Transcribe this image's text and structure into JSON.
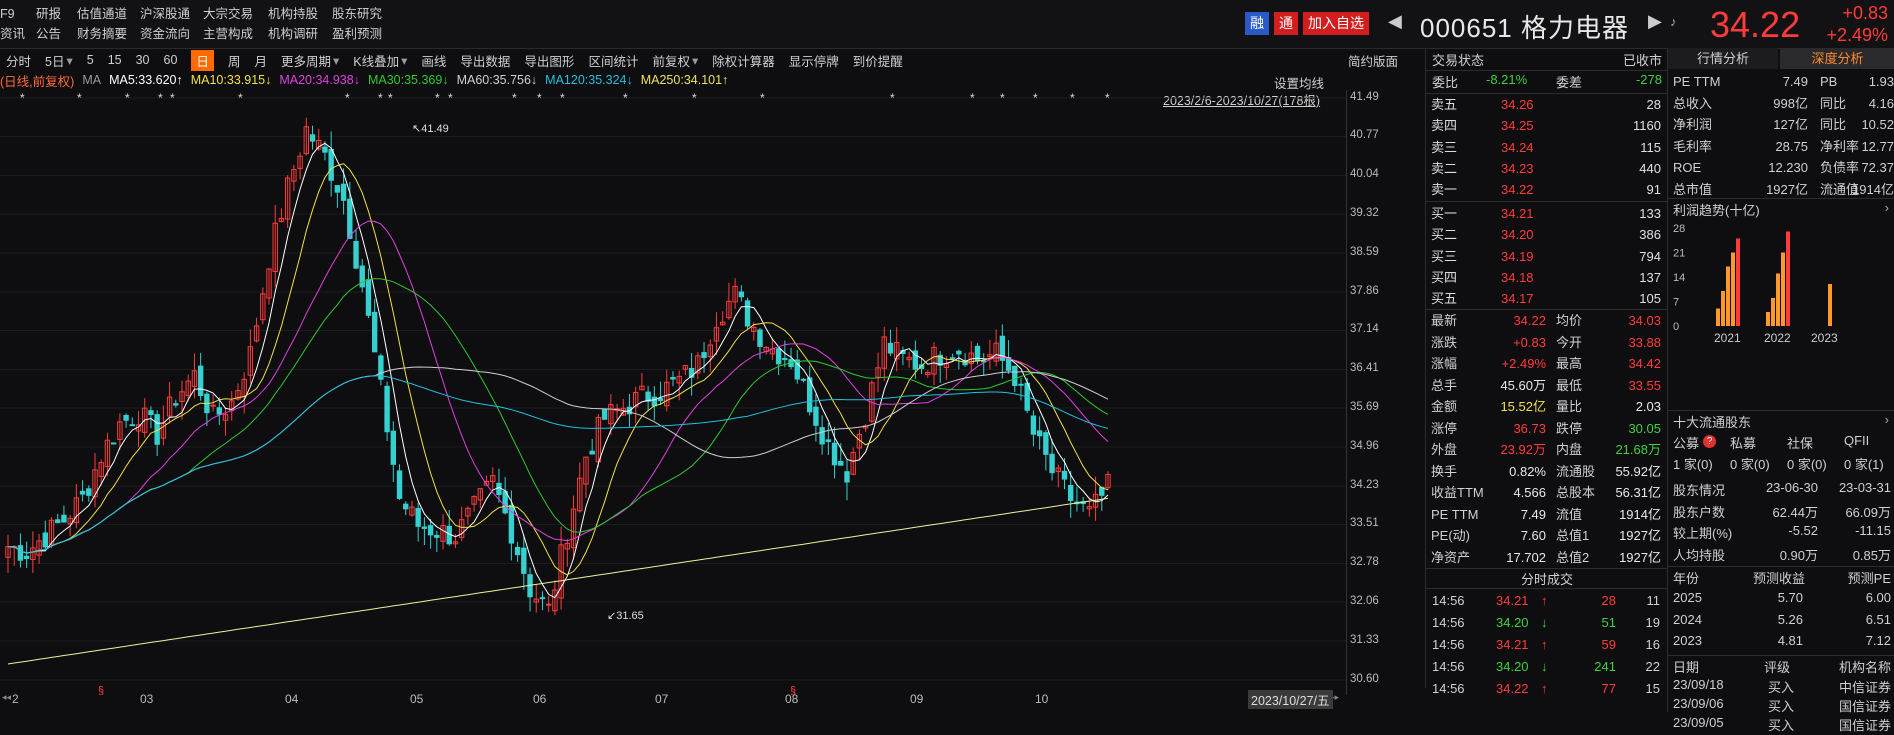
{
  "nav": {
    "col1": [
      "F9",
      "资讯"
    ],
    "col2": [
      "研报",
      "公告"
    ],
    "col3": [
      "估值通道",
      "财务摘要"
    ],
    "col4": [
      "沪深股通",
      "资金流向"
    ],
    "col5": [
      "大宗交易",
      "主营构成"
    ],
    "col6": [
      "机构持股",
      "机构调研"
    ],
    "col7": [
      "股东研究",
      "盈利预测"
    ]
  },
  "header": {
    "badge_rong": "融",
    "badge_tong": "通",
    "add_watch": "加入自选",
    "code": "000651",
    "name": "格力电器",
    "price": "34.22",
    "change": "+0.83",
    "change_pct": "+2.49%"
  },
  "toolbar": {
    "items": [
      "分时",
      "5日",
      "5",
      "15",
      "30",
      "60",
      "日",
      "周",
      "月",
      "更多周期",
      "K线叠加",
      "画线",
      "导出数据",
      "导出图形",
      "区间统计",
      "前复权",
      "除权计算器",
      "显示停牌",
      "到价提醒"
    ],
    "right": "简约版面"
  },
  "ma_legend": {
    "label": "(日线,前复权)",
    "ma": "MA",
    "ma5": "MA5:33.620↑",
    "ma10": "MA10:33.915↓",
    "ma20": "MA20:34.938↓",
    "ma30": "MA30:35.369↓",
    "ma60": "MA60:35.756↓",
    "ma120": "MA120:35.324↓",
    "ma250": "MA250:34.101↑",
    "settings": "设置均线",
    "range": "2023/2/6-2023/10/27(178根)"
  },
  "chart_data": {
    "type": "candlestick",
    "y_ticks": [
      "41.49",
      "40.77",
      "40.04",
      "39.32",
      "38.59",
      "37.86",
      "37.14",
      "36.41",
      "35.69",
      "34.96",
      "34.23",
      "33.51",
      "32.78",
      "32.06",
      "31.33",
      "30.60"
    ],
    "ylim": [
      30.6,
      41.49
    ],
    "x_labels": [
      "2",
      "03",
      "04",
      "05",
      "06",
      "07",
      "08",
      "09",
      "10"
    ],
    "max_label": "41.49",
    "min_label": "31.65",
    "cursor_date": "2023/10/27/五",
    "colors": {
      "up": "#ff3b3b",
      "down": "#35d0d0",
      "ma5": "#ffffff",
      "ma10": "#f2e04a",
      "ma20": "#e040e0",
      "ma30": "#2fc82f",
      "ma60": "#cfcfcf",
      "ma120": "#22c0e0",
      "ma250": "#f0f0a0"
    },
    "trend": [
      33.1,
      33.0,
      33.3,
      33.6,
      34.0,
      34.8,
      35.4,
      35.6,
      35.2,
      35.9,
      36.3,
      35.5,
      35.8,
      36.7,
      38.5,
      39.8,
      40.9,
      40.4,
      39.6,
      38.0,
      36.0,
      34.0,
      33.5,
      33.4,
      33.3,
      33.8,
      34.3,
      33.4,
      32.3,
      31.9,
      33.4,
      34.8,
      35.5,
      35.7,
      35.9,
      36.0,
      36.2,
      36.5,
      37.4,
      37.8,
      37.2,
      36.8,
      36.6,
      35.8,
      35.0,
      34.5,
      35.6,
      36.9,
      36.6,
      36.5,
      36.7,
      36.8,
      36.6,
      36.7,
      36.3,
      35.2,
      34.5,
      34.0,
      33.7,
      34.2
    ]
  },
  "orderbook": {
    "title": "交易状态",
    "status": "已收市",
    "weibi_label": "委比",
    "weibi": "-8.21%",
    "weicha_label": "委差",
    "weicha": "-278",
    "sells": [
      {
        "label": "卖五",
        "price": "34.26",
        "vol": "28"
      },
      {
        "label": "卖四",
        "price": "34.25",
        "vol": "1160"
      },
      {
        "label": "卖三",
        "price": "34.24",
        "vol": "115"
      },
      {
        "label": "卖二",
        "price": "34.23",
        "vol": "440"
      },
      {
        "label": "卖一",
        "price": "34.22",
        "vol": "91"
      }
    ],
    "buys": [
      {
        "label": "买一",
        "price": "34.21",
        "vol": "133"
      },
      {
        "label": "买二",
        "price": "34.20",
        "vol": "386"
      },
      {
        "label": "买三",
        "price": "34.19",
        "vol": "794"
      },
      {
        "label": "买四",
        "price": "34.18",
        "vol": "137"
      },
      {
        "label": "买五",
        "price": "34.17",
        "vol": "105"
      }
    ]
  },
  "quote": [
    {
      "l1": "最新",
      "v1": "34.22",
      "c1": "red",
      "l2": "均价",
      "v2": "34.03",
      "c2": "red"
    },
    {
      "l1": "涨跌",
      "v1": "+0.83",
      "c1": "red",
      "l2": "今开",
      "v2": "33.88",
      "c2": "red"
    },
    {
      "l1": "涨幅",
      "v1": "+2.49%",
      "c1": "red",
      "l2": "最高",
      "v2": "34.42",
      "c2": "red"
    },
    {
      "l1": "总手",
      "v1": "45.60万",
      "c1": "white",
      "l2": "最低",
      "v2": "33.55",
      "c2": "red"
    },
    {
      "l1": "金额",
      "v1": "15.52亿",
      "c1": "yellow",
      "l2": "量比",
      "v2": "2.03",
      "c2": "white"
    },
    {
      "l1": "涨停",
      "v1": "36.73",
      "c1": "red",
      "l2": "跌停",
      "v2": "30.05",
      "c2": "green"
    },
    {
      "l1": "外盘",
      "v1": "23.92万",
      "c1": "red",
      "l2": "内盘",
      "v2": "21.68万",
      "c2": "green"
    },
    {
      "l1": "换手",
      "v1": "0.82%",
      "c1": "white",
      "l2": "流通股",
      "v2": "55.92亿",
      "c2": "white"
    },
    {
      "l1": "收益TTM",
      "v1": "4.566",
      "c1": "white",
      "l2": "总股本",
      "v2": "56.31亿",
      "c2": "white"
    },
    {
      "l1": "PE TTM",
      "v1": "7.49",
      "c1": "white",
      "l2": "流值",
      "v2": "1914亿",
      "c2": "white"
    },
    {
      "l1": "PE(动)",
      "v1": "7.60",
      "c1": "white",
      "l2": "总值1",
      "v2": "1927亿",
      "c2": "white"
    },
    {
      "l1": "净资产",
      "v1": "17.702",
      "c1": "white",
      "l2": "总值2",
      "v2": "1927亿",
      "c2": "white"
    }
  ],
  "trades": {
    "title": "分时成交",
    "rows": [
      {
        "time": "14:56",
        "price": "34.21",
        "arrow": "↑",
        "dir": "red",
        "vol": "28",
        "n": "11"
      },
      {
        "time": "14:56",
        "price": "34.20",
        "arrow": "↓",
        "dir": "green",
        "vol": "51",
        "n": "19"
      },
      {
        "time": "14:56",
        "price": "34.21",
        "arrow": "↑",
        "dir": "red",
        "vol": "59",
        "n": "16"
      },
      {
        "time": "14:56",
        "price": "34.20",
        "arrow": "↓",
        "dir": "green",
        "vol": "241",
        "n": "22"
      },
      {
        "time": "14:56",
        "price": "34.22",
        "arrow": "↑",
        "dir": "red",
        "vol": "77",
        "n": "15"
      }
    ]
  },
  "analysis": {
    "tab1": "行情分析",
    "tab2": "深度分析",
    "fin": [
      {
        "a": "PE TTM",
        "b": "7.49",
        "c": "PB",
        "d": "1.93"
      },
      {
        "a": "总收入",
        "b": "998亿",
        "c": "同比",
        "d": "4.16"
      },
      {
        "a": "净利润",
        "b": "127亿",
        "c": "同比",
        "d": "10.52"
      },
      {
        "a": "毛利率",
        "b": "28.75",
        "c": "净利率",
        "d": "12.77"
      },
      {
        "a": "ROE",
        "b": "12.230",
        "c": "负债率",
        "d": "72.37"
      },
      {
        "a": "总市值",
        "b": "1927亿",
        "c": "流通值",
        "d": "1914亿"
      }
    ],
    "profit_title": "利润趋势(十亿)",
    "profit_y": [
      "28",
      "21",
      "14",
      "7",
      "0"
    ],
    "profit_years": [
      "2021",
      "2022",
      "2023"
    ],
    "profit_bars": [
      [
        5,
        10,
        17,
        21,
        25
      ],
      [
        4,
        8,
        15,
        21,
        27
      ],
      [
        0,
        0,
        0,
        12,
        0
      ]
    ],
    "holders_title": "十大流通股东",
    "holder_types": [
      "公募",
      "私募",
      "社保",
      "QFII"
    ],
    "holder_counts": [
      "1 家(0)",
      "0 家(0)",
      "0 家(0)",
      "0 家(1)"
    ],
    "holder_info": [
      {
        "a": "股东情况",
        "b": "23-06-30",
        "c": "23-03-31"
      },
      {
        "a": "股东户数",
        "b": "62.44万",
        "c": "66.09万"
      },
      {
        "a": "较上期(%)",
        "b": "-5.52",
        "c": "-11.15"
      },
      {
        "a": "人均持股",
        "b": "0.90万",
        "c": "0.85万"
      }
    ],
    "forecast_header": [
      "年份",
      "预测收益",
      "预测PE"
    ],
    "forecast": [
      {
        "y": "2025",
        "e": "5.70",
        "pe": "6.00"
      },
      {
        "y": "2024",
        "e": "5.26",
        "pe": "6.51"
      },
      {
        "y": "2023",
        "e": "4.81",
        "pe": "7.12"
      }
    ],
    "rating_header": [
      "日期",
      "评级",
      "机构名称"
    ],
    "ratings": [
      {
        "d": "23/09/18",
        "r": "买入",
        "o": "中信证券"
      },
      {
        "d": "23/09/06",
        "r": "买入",
        "o": "国信证券"
      },
      {
        "d": "23/09/05",
        "r": "买入",
        "o": "国信证券"
      }
    ]
  }
}
